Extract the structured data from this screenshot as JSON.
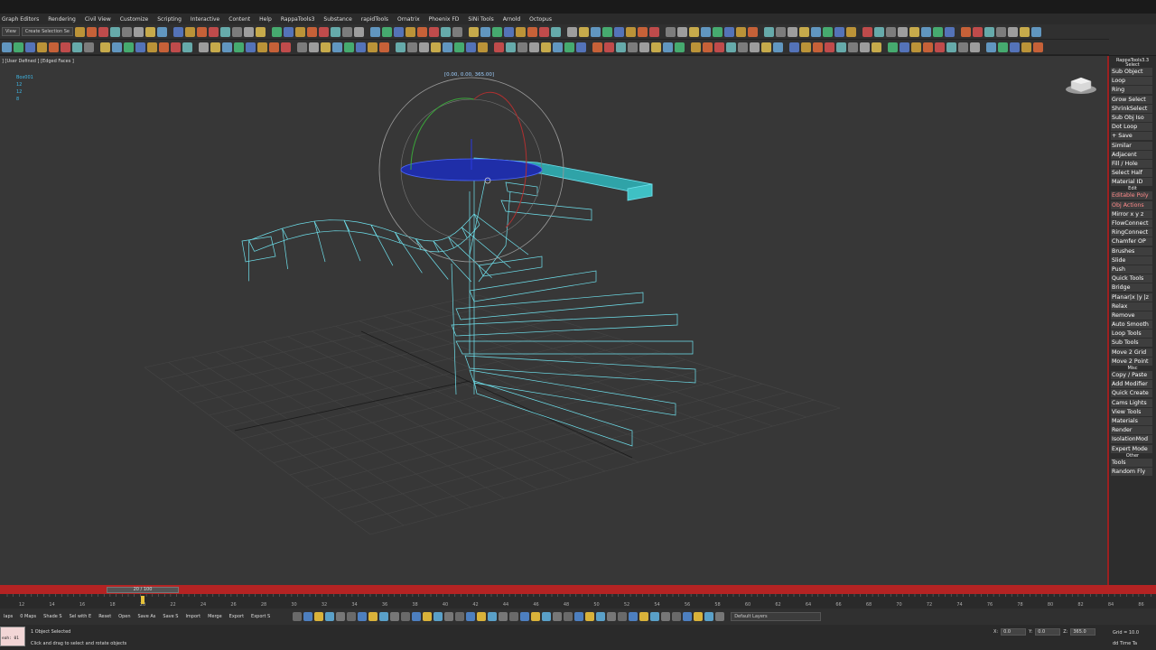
{
  "menubar": {
    "items": [
      "Graph Editors",
      "Rendering",
      "Civil View",
      "Customize",
      "Scripting",
      "Interactive",
      "Content",
      "Help",
      "RappaTools3",
      "Substance",
      "rapidTools",
      "Ornatrix",
      "Phoenix FD",
      "SiNi Tools",
      "Arnold",
      "Octopus"
    ]
  },
  "toolbar": {
    "view_dropdown": "View",
    "selection_set": "Create Selection Se"
  },
  "viewport": {
    "label": "] [User Defined ] [Edged Faces ]",
    "stats": {
      "name": "Box001",
      "line1": "12",
      "line2": "12",
      "line3": "8"
    },
    "coord_readout": "[0.00, 0.00, 365.00]"
  },
  "right_panel": {
    "title": "RappaTools3.3",
    "sections": {
      "select": "Select",
      "edit": "Edit",
      "misc": "Misc",
      "other": "Other"
    },
    "select_items": [
      "Sub Object",
      "Loop",
      "Ring",
      "Grow Select",
      "ShrinkSelect",
      "Sub Obj Iso",
      "Dot Loop",
      "+ Save",
      "Similar",
      "Adjacent",
      "Fill / Hole",
      "Select Half",
      "Material ID"
    ],
    "edit_items": [
      "Editable Poly",
      "Obj Actions",
      "Mirror x y z",
      "FlowConnect",
      "RingConnect",
      "Chamfer OP",
      "Brushes",
      "Slide",
      "Push",
      "Quick Tools",
      "Bridge",
      "Planar|x |y |z",
      "Relax",
      "Remove",
      "Auto Smooth",
      "Loop Tools",
      "Sub Tools",
      "Move 2 Grid",
      "Move 2 Point"
    ],
    "misc_items": [
      "Copy / Paste",
      "Add Modifier",
      "Quick Create",
      "Cams Lights",
      "View Tools",
      "Materials",
      "Render",
      "IsolationMod",
      "Expert Mode"
    ],
    "other_items": [
      "Tools",
      "Random Fly"
    ]
  },
  "timeline": {
    "slider": "20 / 100",
    "ticks": [
      "12",
      "14",
      "16",
      "18",
      "20",
      "22",
      "24",
      "26",
      "28",
      "30",
      "32",
      "34",
      "36",
      "38",
      "40",
      "42",
      "44",
      "46",
      "48",
      "50",
      "52",
      "54",
      "56",
      "58",
      "60",
      "62",
      "64",
      "66",
      "68",
      "70",
      "72",
      "74",
      "76",
      "78",
      "80",
      "82",
      "84",
      "86"
    ]
  },
  "bottom_toolbar": {
    "buttons": [
      "laps",
      "0 Maps",
      "Shade S",
      "Sel with E",
      "Reset",
      "Open",
      "Save As",
      "Save S",
      "Import",
      "Merge",
      "Export",
      "Export S"
    ],
    "layer_dropdown": "Default Layers"
  },
  "status": {
    "maxscript": "eah: 01",
    "selection": "1 Object Selected",
    "prompt": "Click and drag to select and rotate objects",
    "x_label": "X:",
    "x": "0.0",
    "y_label": "Y:",
    "y": "0.0",
    "z_label": "Z:",
    "z": "365.0",
    "grid": "Grid = 10.0",
    "time_tag": "dd Time Ta"
  },
  "colors": {
    "accent_red": "#b42323",
    "wire_cyan": "#6fe2ee",
    "selected_fill": "#2fa3a8",
    "gizmo_blue": "#1f2ea8"
  }
}
